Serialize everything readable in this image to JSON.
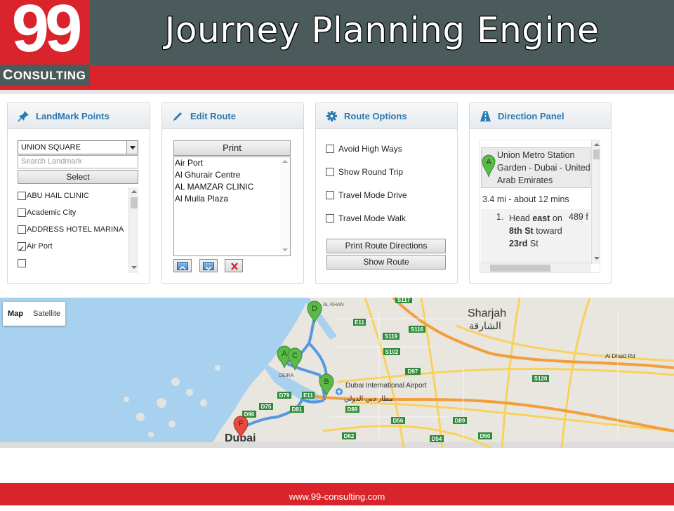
{
  "header": {
    "logo_number": "99",
    "logo_text": "Consulting",
    "title": "Journey Planning Engine"
  },
  "landmark_panel": {
    "title": "LandMark Points",
    "selected_value": "UNION SQUARE",
    "search_placeholder": "Search Landmark",
    "select_label": "Select",
    "items": [
      {
        "label": "ABU HAIL CLINIC",
        "checked": false
      },
      {
        "label": "Academic City",
        "checked": false
      },
      {
        "label": "ADDRESS HOTEL MARINA",
        "checked": false
      },
      {
        "label": "Air Port",
        "checked": true
      },
      {
        "label": "",
        "checked": false
      }
    ]
  },
  "edit_route_panel": {
    "title": "Edit Route",
    "print_label": "Print",
    "stops": [
      "Air Port",
      "Al Ghurair Centre",
      "AL MAMZAR CLINIC",
      "Al Mulla Plaza"
    ]
  },
  "route_options_panel": {
    "title": "Route Options",
    "options": [
      "Avoid High Ways",
      "Show Round Trip",
      "Travel Mode Drive",
      "Travel Mode Walk"
    ],
    "print_directions_label": "Print Route Directions",
    "show_route_label": "Show Route"
  },
  "direction_panel": {
    "title": "Direction Panel",
    "start_marker": "A",
    "start_address": "Union Metro Station Garden - Dubai - United Arab Emirates",
    "summary": "3.4 mi - about 12 mins",
    "step_number": "1.",
    "step_parts": [
      "Head ",
      "east",
      " on ",
      "8th St",
      " toward ",
      "23rd",
      " St"
    ],
    "step_distance": "489 f"
  },
  "map": {
    "map_label": "Map",
    "satellite_label": "Satellite",
    "labels": {
      "sharjah": "Sharjah",
      "sharjah_ar": "الشارقة",
      "dubai": "Dubai",
      "airport": "Dubai International Airport",
      "airport_ar": "مطار دبي الدولي",
      "al_dhaid_rd": "Al Dhaid Rd",
      "deira": "DEIRA",
      "al_khan": "AL KHAN"
    },
    "roads": [
      "S117",
      "E11",
      "S116",
      "S119",
      "S102",
      "D97",
      "D79",
      "D75",
      "E11",
      "D81",
      "D89",
      "D90",
      "D56",
      "D89",
      "S120",
      "D62",
      "D54",
      "D50"
    ],
    "markers": [
      "D",
      "A",
      "C",
      "B",
      "F"
    ],
    "colors": {
      "route": "#4a90e2",
      "marker_green": "#5bb94a",
      "marker_red": "#e34b40",
      "road_yellow": "#f8d25e",
      "road_orange": "#f29e3b",
      "water": "#a8d1f0"
    }
  },
  "footer": {
    "url": "www.99-consulting.com"
  }
}
